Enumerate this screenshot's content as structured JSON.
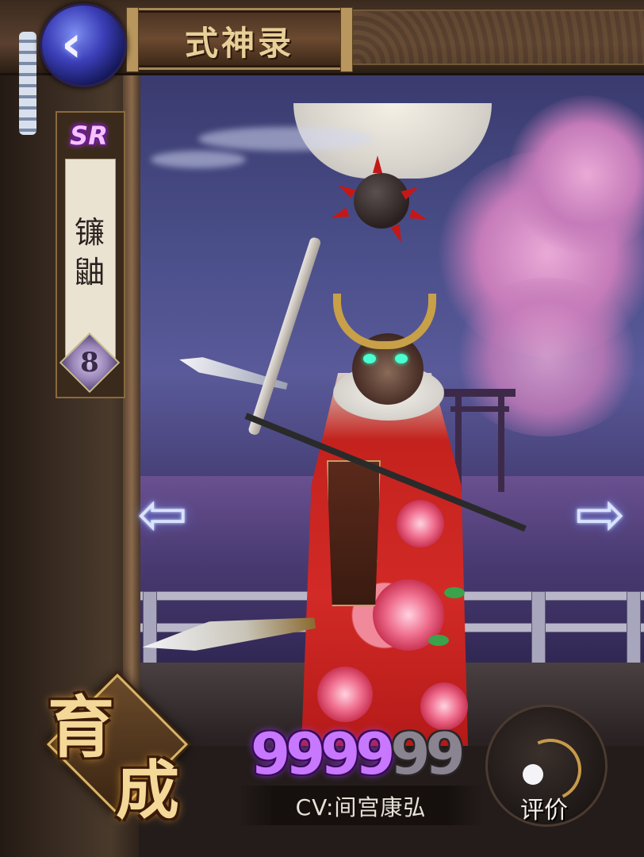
{
  "header": {
    "title": "式神录",
    "back_icon": "chevron-left-icon"
  },
  "shikigami": {
    "rarity": "SR",
    "name_line1": "镰",
    "name_line2": "鼬",
    "level": "8"
  },
  "navigation": {
    "prev_icon": "arrow-left-icon",
    "next_icon": "arrow-right-icon"
  },
  "actions": {
    "train_line1": "育",
    "train_line2": "成",
    "rate_label": "评价"
  },
  "likes": {
    "lit_digits": "9999",
    "dim_digits": "99"
  },
  "voice": {
    "cv_text": "CV:间宫康弘"
  },
  "colors": {
    "rarity": "#c878ff",
    "accent_gold": "#d8b468"
  }
}
